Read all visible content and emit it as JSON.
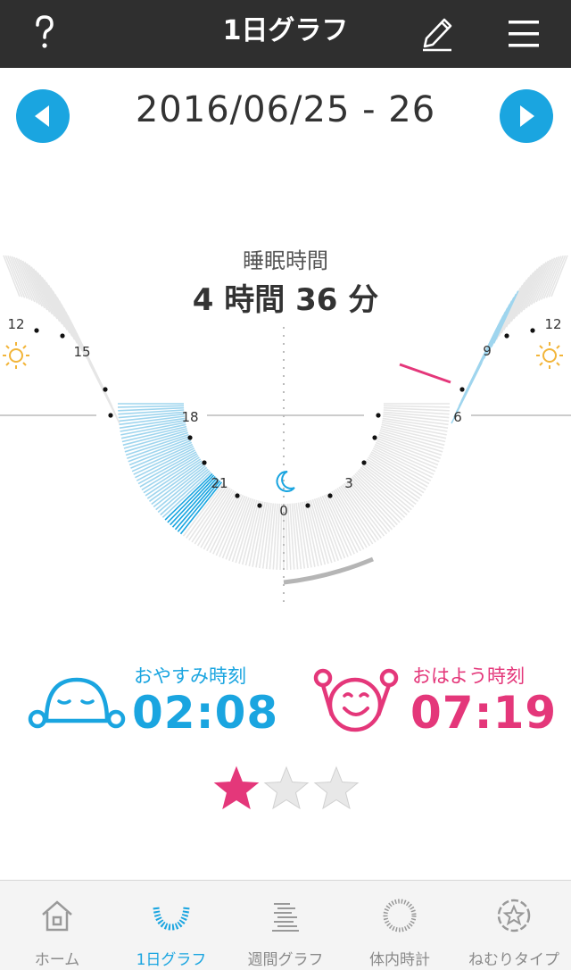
{
  "header": {
    "title": "1日グラフ",
    "help_icon": "question-icon",
    "edit_icon": "pencil-icon",
    "menu_icon": "hamburger-menu-icon"
  },
  "date_nav": {
    "date_range": "2016/06/25 - 26",
    "prev_icon": "arrow-left-icon",
    "next_icon": "arrow-right-icon"
  },
  "sleep": {
    "label": "睡眠時間",
    "duration": "4 時間 36 分"
  },
  "dial": {
    "hour_labels": {
      "h12_left": "12",
      "h15": "15",
      "h18": "18",
      "h21": "21",
      "h0": "0",
      "h3": "3",
      "h6": "6",
      "h9": "9",
      "h12_right": "12"
    },
    "sun_icon": "sun-icon",
    "moon_icon": "moon-icon",
    "colors": {
      "sleep": "#1aa5e0",
      "light_sleep": "#9fd5ee",
      "wake": "#e4377a",
      "idle": "#e6e6e6"
    }
  },
  "bedtime": {
    "label": "おやすみ時刻",
    "time": "02:08",
    "icon": "sleeping-face-icon",
    "color": "#1aa5e0"
  },
  "wakeup": {
    "label": "おはよう時刻",
    "time": "07:19",
    "icon": "waking-face-icon",
    "color": "#e4377a"
  },
  "rating": {
    "stars_filled": 1,
    "stars_total": 3
  },
  "bottom_nav": {
    "items": [
      {
        "label": "ホーム",
        "icon": "home-icon"
      },
      {
        "label": "1日グラフ",
        "icon": "day-graph-icon"
      },
      {
        "label": "週間グラフ",
        "icon": "week-graph-icon"
      },
      {
        "label": "体内時計",
        "icon": "body-clock-icon"
      },
      {
        "label": "ねむりタイプ",
        "icon": "sleep-type-icon"
      }
    ],
    "active_index": 1
  }
}
